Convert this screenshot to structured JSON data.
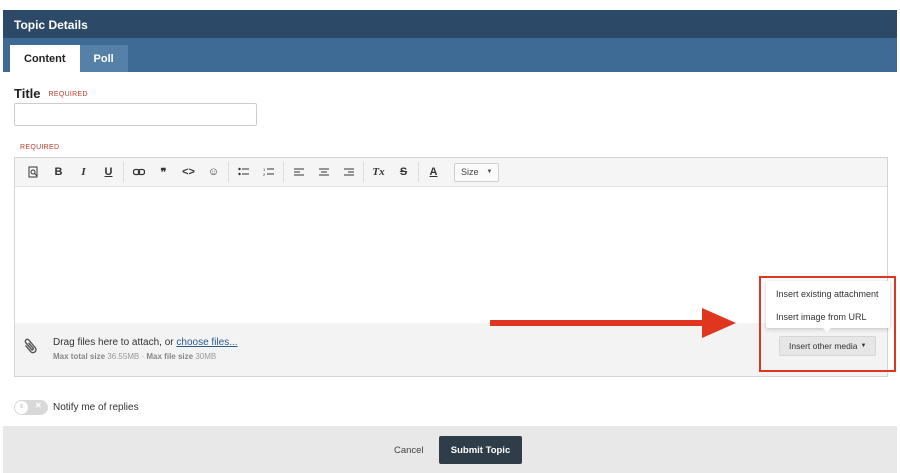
{
  "header": {
    "title": "Topic Details",
    "tabs": [
      {
        "label": "Content",
        "active": true
      },
      {
        "label": "Poll",
        "active": false
      }
    ]
  },
  "form": {
    "title_label": "Title",
    "title_required": "REQUIRED",
    "title_value": "",
    "content_required": "REQUIRED"
  },
  "toolbar": {
    "buttons": [
      {
        "icon": "preview-icon",
        "glyph": "🔍"
      },
      {
        "icon": "bold-icon",
        "glyph": "B"
      },
      {
        "icon": "italic-icon",
        "glyph": "I"
      },
      {
        "icon": "underline-icon",
        "glyph": "U"
      },
      {
        "icon": "link-icon",
        "glyph": "⛓"
      },
      {
        "icon": "quote-icon",
        "glyph": "❞"
      },
      {
        "icon": "code-icon",
        "glyph": "<>"
      },
      {
        "icon": "emoji-icon",
        "glyph": "☺"
      },
      {
        "icon": "bullet-list-icon",
        "glyph": "☰"
      },
      {
        "icon": "numbered-list-icon",
        "glyph": "☷"
      },
      {
        "icon": "align-left-icon",
        "glyph": "≡"
      },
      {
        "icon": "align-center-icon",
        "glyph": "≡"
      },
      {
        "icon": "align-right-icon",
        "glyph": "≡"
      },
      {
        "icon": "clear-format-icon",
        "glyph": "Tx"
      },
      {
        "icon": "strikethrough-icon",
        "glyph": "S"
      },
      {
        "icon": "text-color-icon",
        "glyph": "A"
      }
    ],
    "size_label": "Size"
  },
  "attachments": {
    "drag_text": "Drag files here to attach, or ",
    "choose_link": "choose files...",
    "max_total_label": "Max total size",
    "max_total_value": "36.55MB",
    "separator": " · ",
    "max_file_label": "Max file size",
    "max_file_value": "30MB",
    "media_button": "Insert other media"
  },
  "media_menu": {
    "items": [
      "Insert existing attachment",
      "Insert image from URL"
    ]
  },
  "notify": {
    "label": "Notify me of replies",
    "enabled": false
  },
  "footer": {
    "cancel": "Cancel",
    "submit": "Submit Topic"
  },
  "colors": {
    "header_dark": "#2c4a68",
    "header_blue": "#3e6b96",
    "required_red": "#c0392b",
    "annotation_red": "#e03620",
    "submit_bg": "#2f3d48"
  }
}
